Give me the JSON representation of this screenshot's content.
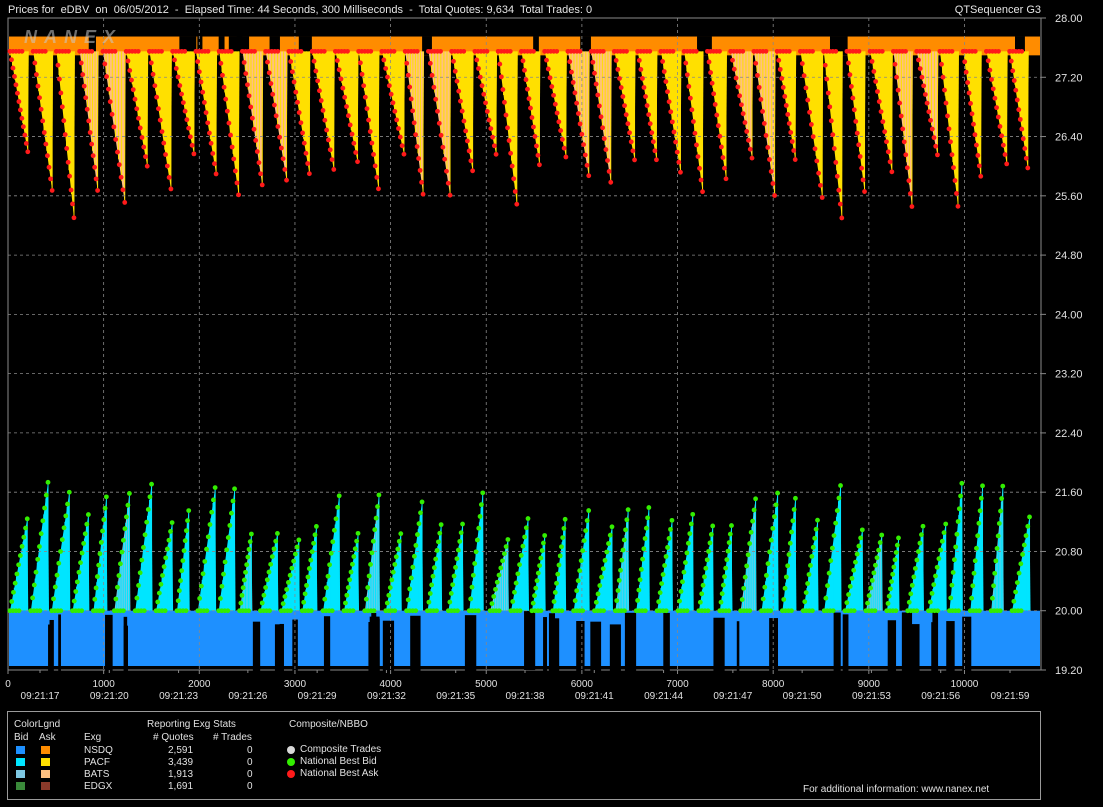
{
  "header": {
    "title": "Prices for  eDBV  on  06/05/2012  -  Elapsed Time: 44 Seconds, 300 Milliseconds  -  Total Quotes: 9,634  Total Trades: 0",
    "app": "QTSequencer G3",
    "watermark": "NANEX"
  },
  "chart_data": {
    "type": "area",
    "y_ticks": [
      "28.00",
      "27.20",
      "26.40",
      "25.60",
      "24.80",
      "24.00",
      "23.20",
      "22.40",
      "21.60",
      "20.80",
      "20.00",
      "19.20"
    ],
    "ylim": [
      19.2,
      28.0
    ],
    "x_ticks": [
      "0",
      "1000",
      "2000",
      "3000",
      "4000",
      "5000",
      "6000",
      "7000",
      "8000",
      "9000",
      "10000"
    ],
    "xlim": [
      0,
      10800
    ],
    "time_ticks": [
      "09:21:17",
      "09:21:20",
      "09:21:23",
      "09:21:26",
      "09:21:29",
      "09:21:32",
      "09:21:35",
      "09:21:38",
      "09:21:41",
      "09:21:44",
      "09:21:47",
      "09:21:50",
      "09:21:53",
      "09:21:56",
      "09:21:59"
    ],
    "grid": true,
    "ask_range": [
      25.3,
      27.55
    ],
    "bid_range": [
      20.0,
      21.75
    ],
    "ask_cycles": 44,
    "bid_cycles": 49,
    "colors": {
      "background": "#000000",
      "grid": "#888888",
      "nsdq_bid": "#1e90ff",
      "pacf_bid": "#00e5ff",
      "bats_bid": "#7ec8e3",
      "edgx_bid": "#3a8a3a",
      "nsdq_ask": "#ff8c00",
      "pacf_ask": "#ffe000",
      "bats_ask": "#ffc080",
      "edgx_ask": "#8b3a2a",
      "best_bid": "#33ee00",
      "best_ask": "#ff1a1a"
    }
  },
  "legend": {
    "color_legend_title": "ColorLgnd",
    "bid_label": "Bid",
    "ask_label": "Ask",
    "exg_label": "Exg",
    "stats_title": "Reporting Exg Stats",
    "quotes_header": "# Quotes",
    "trades_header": "# Trades",
    "composite_title": "Composite/NBBO",
    "exchanges": [
      {
        "name": "NSDQ",
        "quotes": "2,591",
        "trades": "0"
      },
      {
        "name": "PACF",
        "quotes": "3,439",
        "trades": "0"
      },
      {
        "name": "BATS",
        "quotes": "1,913",
        "trades": "0"
      },
      {
        "name": "EDGX",
        "quotes": "1,691",
        "trades": "0"
      }
    ],
    "composite_items": [
      {
        "label": "Composite Trades",
        "color": "#d8d8d8"
      },
      {
        "label": "National Best Bid",
        "color": "#33ee00"
      },
      {
        "label": "National Best Ask",
        "color": "#ff1a1a"
      }
    ],
    "footer": "For additional information: www.nanex.net"
  }
}
